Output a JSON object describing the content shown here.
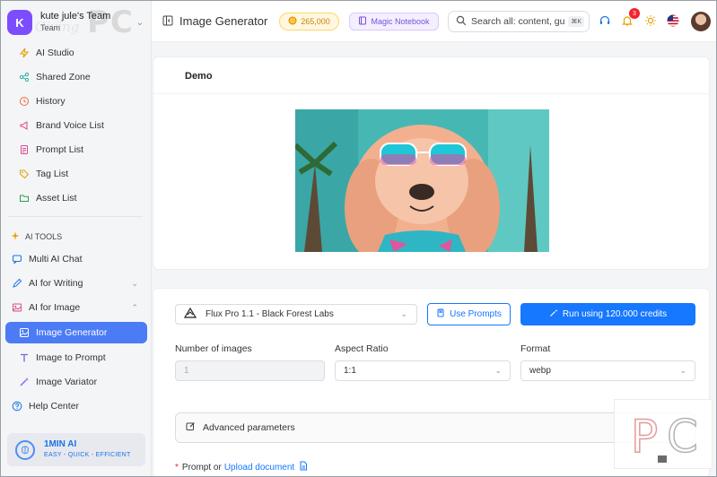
{
  "team": {
    "initial": "K",
    "name": "kute jule's Team",
    "role": "Team"
  },
  "watermark": {
    "brand": "PC",
    "script": "Giving"
  },
  "sidebar": {
    "items": [
      {
        "label": "AI Studio",
        "icon": "lightning-icon"
      },
      {
        "label": "Shared Zone",
        "icon": "share-icon"
      },
      {
        "label": "History",
        "icon": "history-icon"
      },
      {
        "label": "Brand Voice List",
        "icon": "megaphone-icon"
      },
      {
        "label": "Prompt List",
        "icon": "document-icon"
      },
      {
        "label": "Tag List",
        "icon": "tag-icon"
      },
      {
        "label": "Asset List",
        "icon": "folder-icon"
      }
    ],
    "tools_label": "AI TOOLS",
    "tools": [
      {
        "label": "Multi AI Chat",
        "icon": "chat-icon"
      },
      {
        "label": "AI for Writing",
        "icon": "pen-icon"
      },
      {
        "label": "AI for Image",
        "icon": "image-icon"
      },
      {
        "label": "Image Generator",
        "icon": "image-gen-icon",
        "active": true
      },
      {
        "label": "Image to Prompt",
        "icon": "text-icon"
      },
      {
        "label": "Image Variator",
        "icon": "wand-icon"
      },
      {
        "label": "Help Center",
        "icon": "help-icon"
      }
    ],
    "promo": {
      "title": "1MIN AI",
      "subtitle": "EASY - QUICK - EFFICIENT"
    }
  },
  "header": {
    "title": "Image Generator",
    "credits": "265,000",
    "magic_notebook": "Magic Notebook",
    "search_placeholder": "Search all: content, gui",
    "search_shortcut": "⌘K",
    "notification_count": "3"
  },
  "demo": {
    "title": "Demo"
  },
  "form": {
    "model": "Flux Pro 1.1 - Black Forest Labs",
    "use_prompts": "Use Prompts",
    "run_button": "Run using 120.000 credits",
    "num_images_label": "Number of images",
    "num_images_value": "1",
    "aspect_label": "Aspect Ratio",
    "aspect_value": "1:1",
    "format_label": "Format",
    "format_value": "webp",
    "advanced": "Advanced parameters",
    "prompt_label": "Prompt or",
    "upload_link": "Upload document"
  },
  "colors": {
    "accent": "#1677ff",
    "active_nav": "#4b7bf5",
    "team_avatar": "#7c4dff"
  }
}
